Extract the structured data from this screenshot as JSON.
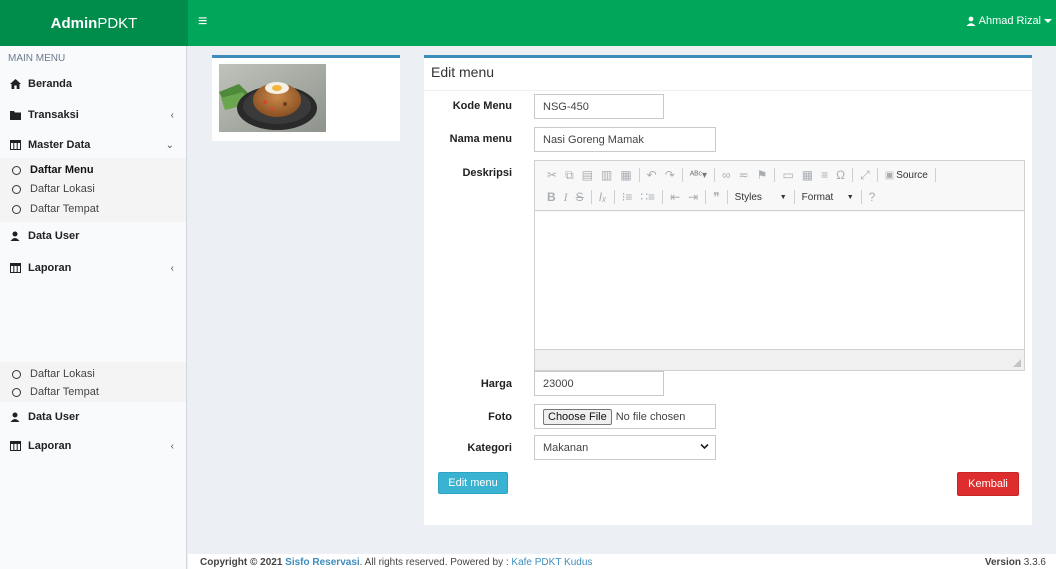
{
  "header": {
    "brand_bold": "Admin",
    "brand_rest": " PDKT",
    "menu_icon": "hamburger-icon",
    "user_name": "Ahmad Rizal",
    "user_icon": "user-icon"
  },
  "sidebar": {
    "section_header": "MAIN MENU",
    "items": [
      {
        "label": "Beranda",
        "icon": "home-icon"
      },
      {
        "label": "Transaksi",
        "icon": "folder-icon",
        "chevron": "‹"
      },
      {
        "label": "Master Data",
        "icon": "table-icon",
        "chevron": "⌄"
      },
      {
        "label": "Data User",
        "icon": "user-icon"
      },
      {
        "label": "Laporan",
        "icon": "table-icon",
        "chevron": "‹"
      }
    ],
    "sub_items": [
      {
        "label": "Daftar Menu",
        "active": true
      },
      {
        "label": "Daftar Lokasi"
      },
      {
        "label": "Daftar Tempat"
      }
    ],
    "repeat_sub_items": [
      {
        "label": "Daftar Lokasi"
      },
      {
        "label": "Daftar Tempat"
      }
    ],
    "repeat_items": [
      {
        "label": "Data User",
        "icon": "user-icon"
      },
      {
        "label": "Laporan",
        "icon": "table-icon",
        "chevron": "‹"
      }
    ]
  },
  "form": {
    "title": "Edit menu",
    "kode_label": "Kode Menu",
    "kode_value": "NSG-450",
    "nama_label": "Nama menu",
    "nama_value": "Nasi Goreng Mamak",
    "deskripsi_label": "Deskripsi",
    "harga_label": "Harga",
    "harga_value": "23000",
    "foto_label": "Foto",
    "file_button": "Choose File",
    "file_status": "No file chosen",
    "kategori_label": "Kategori",
    "kategori_value": "Makanan",
    "edit_button": "Edit menu",
    "back_button": "Kembali"
  },
  "editor": {
    "source_label": "Source",
    "styles_label": "Styles",
    "format_label": "Format",
    "help_label": "?"
  },
  "footer": {
    "copyright_prefix": "Copyright © 2021 ",
    "app_name": "Sisfo Reservasi",
    "copyright_suffix": ". All rights reserved. Powered by : ",
    "powered_by": "Kafe PDKT Kudus",
    "version_label": "Version",
    "version_number": "3.3.6"
  },
  "colors": {
    "header_green": "#00a65a",
    "brand_green": "#008d4c",
    "box_border_blue": "#3c8dbc",
    "edit_button": "#3ab3d3",
    "back_button": "#dd2d2d"
  }
}
